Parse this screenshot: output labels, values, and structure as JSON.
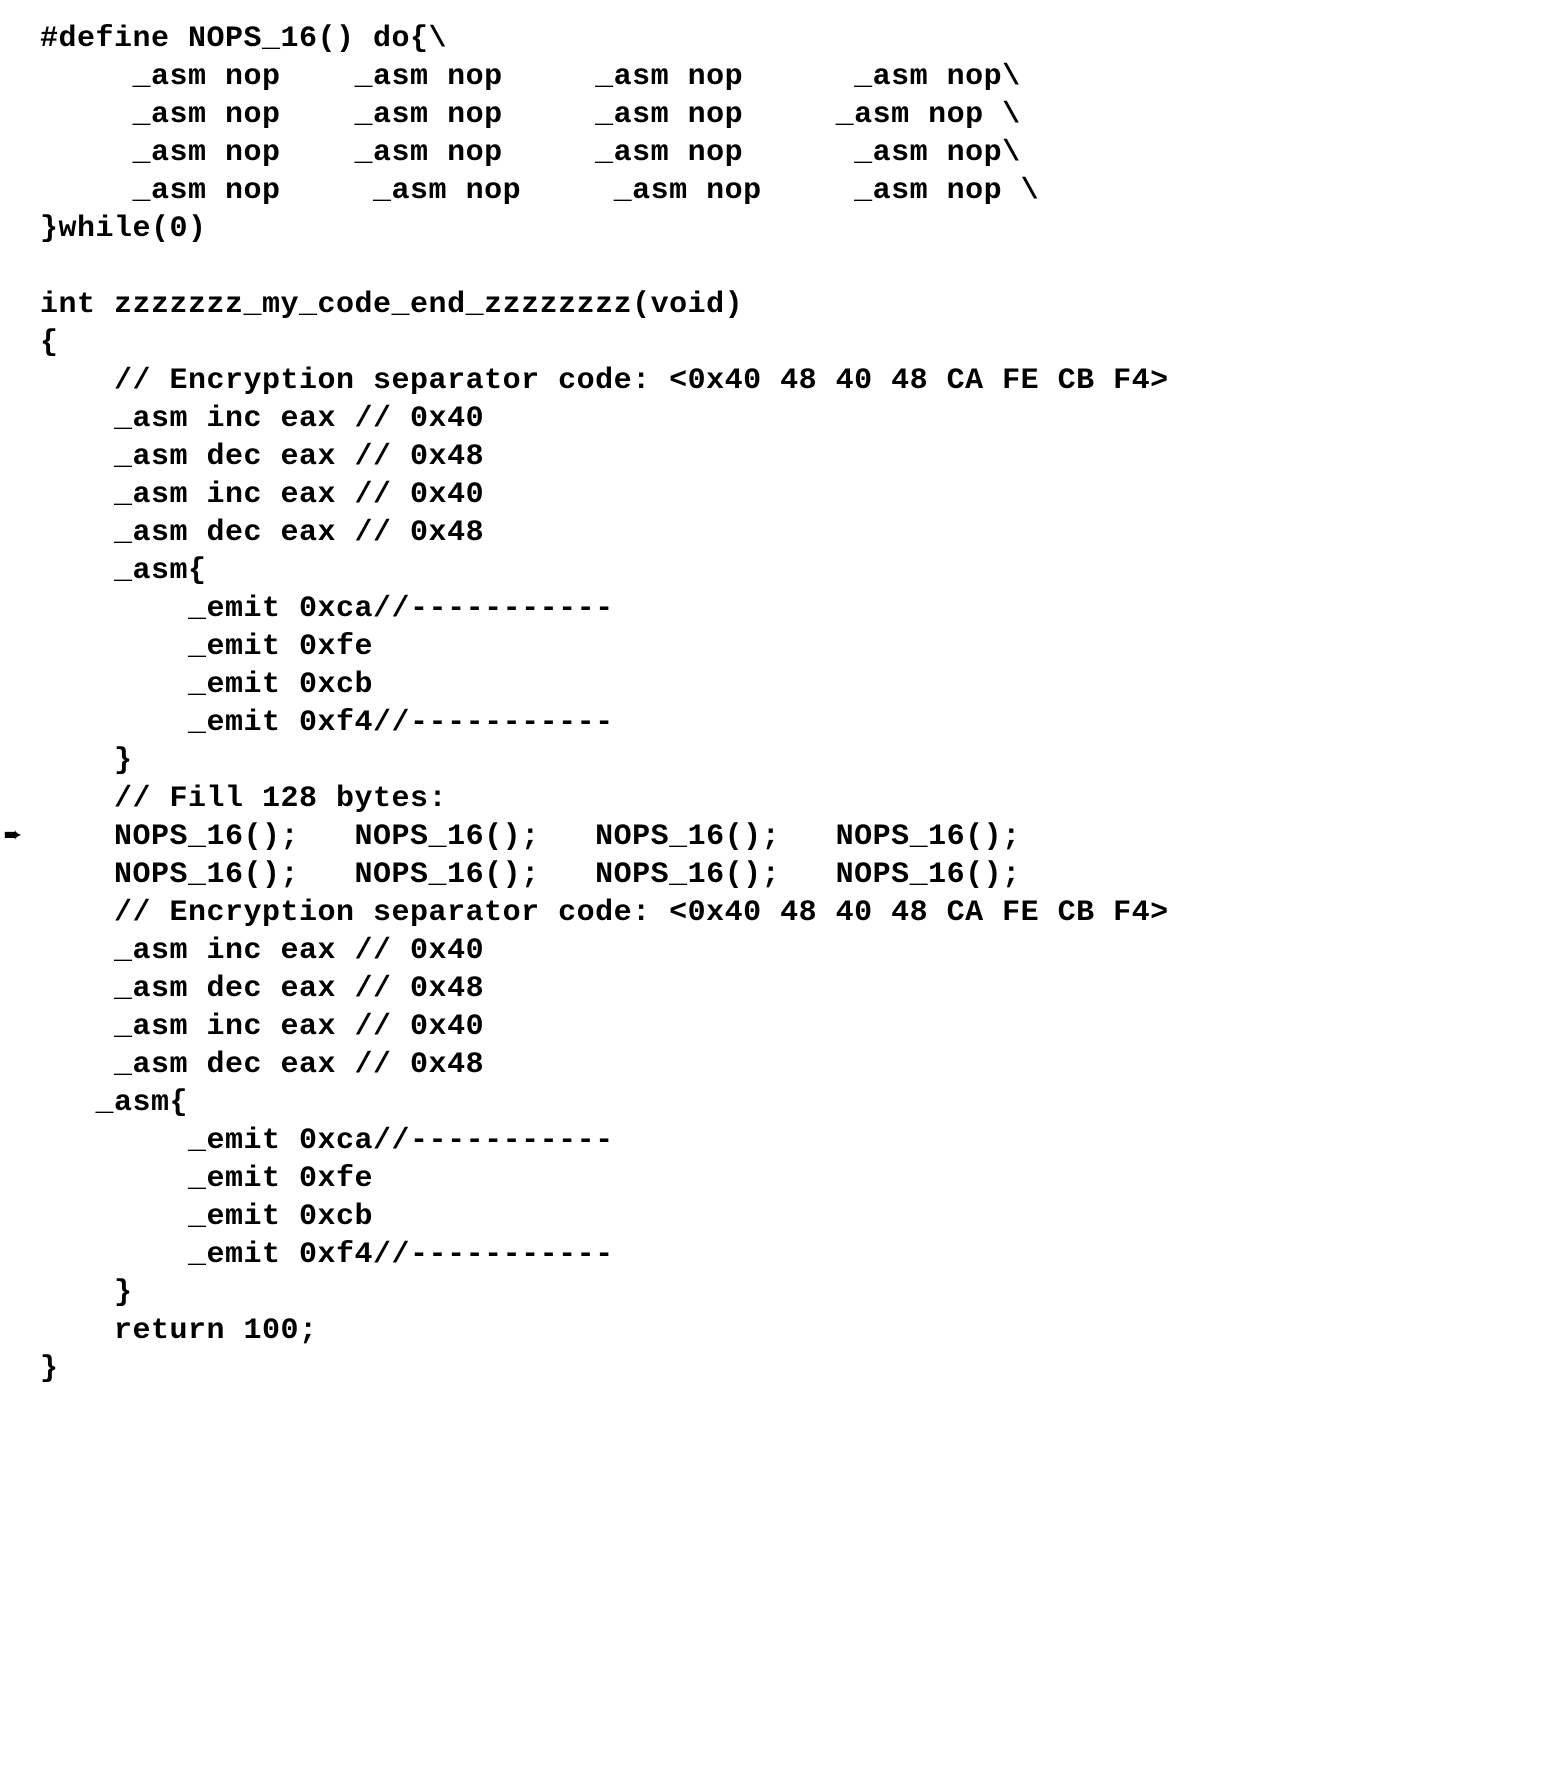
{
  "code": {
    "lines": [
      "#define NOPS_16() do{\\",
      "     _asm nop    _asm nop     _asm nop      _asm nop\\",
      "     _asm nop    _asm nop     _asm nop     _asm nop \\",
      "     _asm nop    _asm nop     _asm nop      _asm nop\\",
      "     _asm nop     _asm nop     _asm nop     _asm nop \\",
      "}while(0)",
      "",
      "int zzzzzzz_my_code_end_zzzzzzzz(void)",
      "{",
      "    // Encryption separator code: <0x40 48 40 48 CA FE CB F4>",
      "    _asm inc eax // 0x40",
      "    _asm dec eax // 0x48",
      "    _asm inc eax // 0x40",
      "    _asm dec eax // 0x48",
      "    _asm{",
      "        _emit 0xca//-----------",
      "        _emit 0xfe",
      "        _emit 0xcb",
      "        _emit 0xf4//-----------",
      "    }",
      "    // Fill 128 bytes:",
      "    NOPS_16();   NOPS_16();   NOPS_16();   NOPS_16();",
      "    NOPS_16();   NOPS_16();   NOPS_16();   NOPS_16();",
      "    // Encryption separator code: <0x40 48 40 48 CA FE CB F4>",
      "    _asm inc eax // 0x40",
      "    _asm dec eax // 0x48",
      "    _asm inc eax // 0x40",
      "    _asm dec eax // 0x48",
      "   _asm{",
      "        _emit 0xca//-----------",
      "        _emit 0xfe",
      "        _emit 0xcb",
      "        _emit 0xf4//-----------",
      "    }",
      "    return 100;",
      "}"
    ]
  },
  "marker": {
    "glyph": "➨",
    "line_index": 21
  }
}
